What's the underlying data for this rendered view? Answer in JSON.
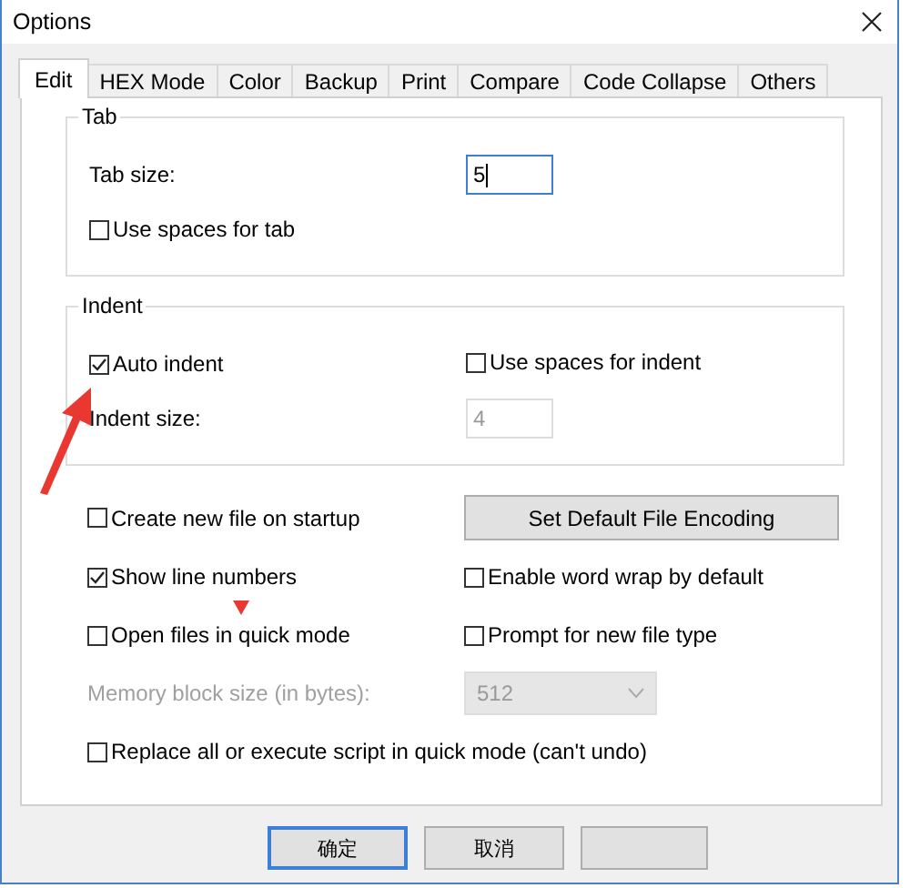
{
  "window": {
    "title": "Options"
  },
  "tabs": [
    {
      "label": "Edit",
      "selected": true
    },
    {
      "label": "HEX Mode",
      "selected": false
    },
    {
      "label": "Color",
      "selected": false
    },
    {
      "label": "Backup",
      "selected": false
    },
    {
      "label": "Print",
      "selected": false
    },
    {
      "label": "Compare",
      "selected": false
    },
    {
      "label": "Code Collapse",
      "selected": false
    },
    {
      "label": "Others",
      "selected": false
    }
  ],
  "tab_group": {
    "title": "Tab",
    "tab_size": {
      "label": "Tab size:",
      "value": "5",
      "focused": true,
      "disabled": false
    },
    "use_spaces": {
      "label": "Use spaces for tab",
      "checked": false
    }
  },
  "indent_group": {
    "title": "Indent",
    "auto_indent": {
      "label": "Auto indent",
      "checked": true
    },
    "use_spaces": {
      "label": "Use spaces for indent",
      "checked": false
    },
    "indent_size": {
      "label": "Indent size:",
      "value": "4",
      "focused": false,
      "disabled": true
    }
  },
  "options": [
    {
      "kind": "checkbox",
      "label": "Create new file on startup",
      "checked": false
    },
    {
      "kind": "button",
      "label": "Set Default File Encoding"
    },
    {
      "kind": "checkbox",
      "label": "Show line numbers",
      "checked": true
    },
    {
      "kind": "checkbox",
      "label": "Enable word wrap by default",
      "checked": false
    },
    {
      "kind": "checkbox",
      "label": "Open files in quick mode",
      "checked": false
    },
    {
      "kind": "checkbox",
      "label": "Prompt for new file type",
      "checked": false
    },
    {
      "kind": "label",
      "label": "Memory block size (in bytes):",
      "disabled": true
    },
    {
      "kind": "select",
      "value": "512",
      "disabled": true
    },
    {
      "kind": "wide_checkbox",
      "label": "Replace all or execute script in quick mode (can't undo)",
      "checked": false
    }
  ],
  "buttons": [
    {
      "label": "确定",
      "default": true
    },
    {
      "label": "取消",
      "default": false
    }
  ]
}
